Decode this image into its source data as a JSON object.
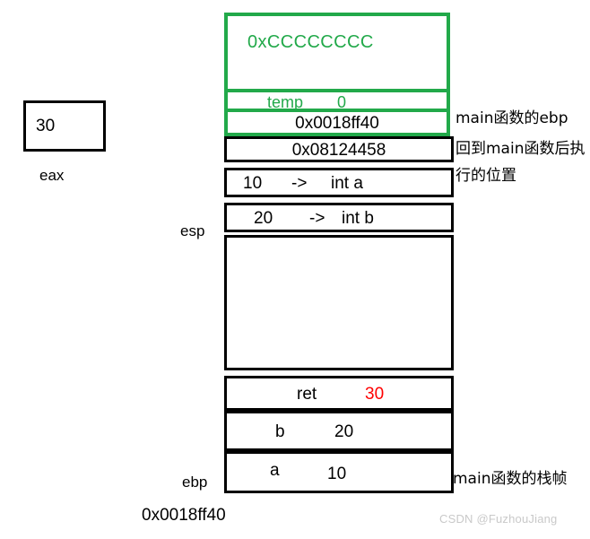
{
  "diagram": {
    "title": "Stack frame diagram",
    "colors": {
      "highlight_green": "#22a94a",
      "alert_red": "#ff0000",
      "outline_black": "#000000",
      "watermark_gray": "#c9c9c9"
    }
  },
  "register": {
    "value": "30",
    "label": "eax"
  },
  "green_block": {
    "uninitialized_pattern": "0xCCCCCCCC",
    "temp_name": "temp",
    "temp_value": "0",
    "saved_ebp": "0x0018ff40"
  },
  "stack_rows": [
    {
      "id": "return-address",
      "text": "0x08124458"
    },
    {
      "id": "param-a",
      "value": "10",
      "arrow": "->",
      "decl": "int a"
    },
    {
      "id": "param-b",
      "value": "20",
      "arrow": "->",
      "decl": "int b"
    },
    {
      "id": "free-space",
      "text": ""
    },
    {
      "id": "ret-slot",
      "name": "ret",
      "value": "30"
    },
    {
      "id": "var-b",
      "name": "b",
      "value": "20"
    },
    {
      "id": "var-a",
      "name": "a",
      "value": "10"
    }
  ],
  "row_text": {
    "return_address": "0x08124458",
    "param_a_value": "10",
    "param_a_arrow": "->",
    "param_a_decl": "int a",
    "param_b_value": "20",
    "param_b_arrow": "->",
    "param_b_decl": "int b",
    "ret_name": "ret",
    "ret_value": "30",
    "var_b_name": "b",
    "var_b_value": "20",
    "var_a_name": "a",
    "var_a_value": "10"
  },
  "pointers": {
    "esp": "esp",
    "ebp": "ebp",
    "base_address": "0x0018ff40"
  },
  "annotations": {
    "saved_ebp": "main函数的ebp",
    "return_line1": "回到main函数后执",
    "return_line2": "行的位置",
    "main_frame": "main函数的栈帧"
  },
  "watermark": {
    "text": "CSDN @FuzhouJiang"
  }
}
